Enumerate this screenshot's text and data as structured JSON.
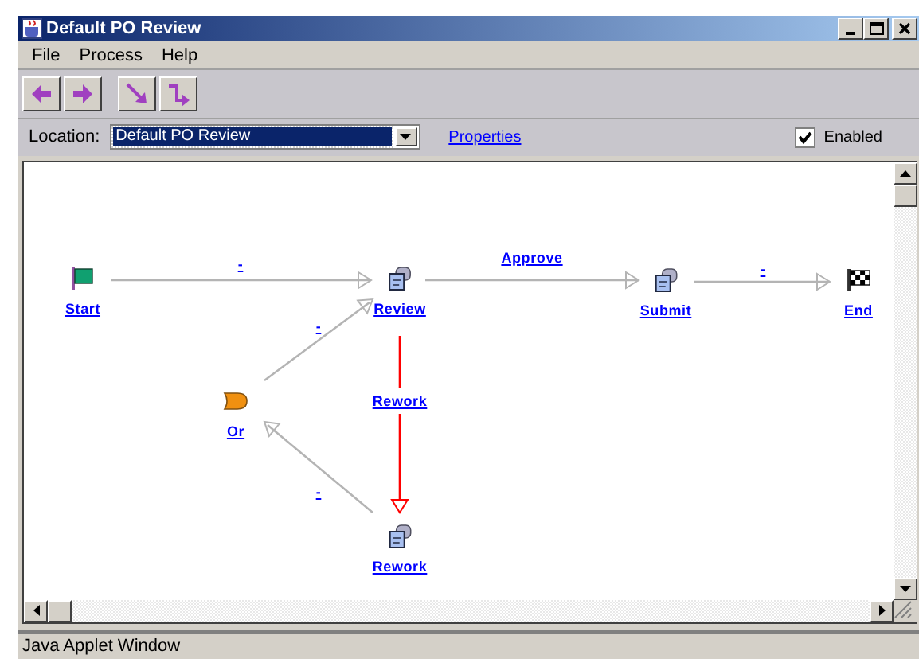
{
  "window": {
    "title": "Default PO Review"
  },
  "menu": [
    {
      "label": "File"
    },
    {
      "label": "Process"
    },
    {
      "label": "Help"
    }
  ],
  "toolbar": [
    {
      "kind": "back"
    },
    {
      "kind": "forward"
    },
    {
      "kind": "straight"
    },
    {
      "kind": "elbow"
    }
  ],
  "location": {
    "label": "Location:",
    "value": "Default PO Review"
  },
  "properties_link": "Properties",
  "enabled": {
    "label": "Enabled",
    "checked": true
  },
  "diagram": {
    "nodes": [
      {
        "kind": "start",
        "label": "Start"
      },
      {
        "kind": "activity",
        "label": "Review"
      },
      {
        "kind": "activity",
        "label": "Submit"
      },
      {
        "kind": "end",
        "label": "End"
      },
      {
        "kind": "or",
        "label": "Or"
      },
      {
        "kind": "activity",
        "label": "Rework"
      }
    ],
    "edges": [
      {
        "label": "-",
        "color": "#b4b4b4"
      },
      {
        "label": "Approve",
        "color": "#b4b4b4"
      },
      {
        "label": "-",
        "color": "#b4b4b4"
      },
      {
        "label": "-",
        "color": "#b4b4b4"
      },
      {
        "label": "Rework",
        "color": "#ff0000"
      },
      {
        "label": "-",
        "color": "#b4b4b4"
      }
    ]
  },
  "status_bar": "Java Applet Window"
}
